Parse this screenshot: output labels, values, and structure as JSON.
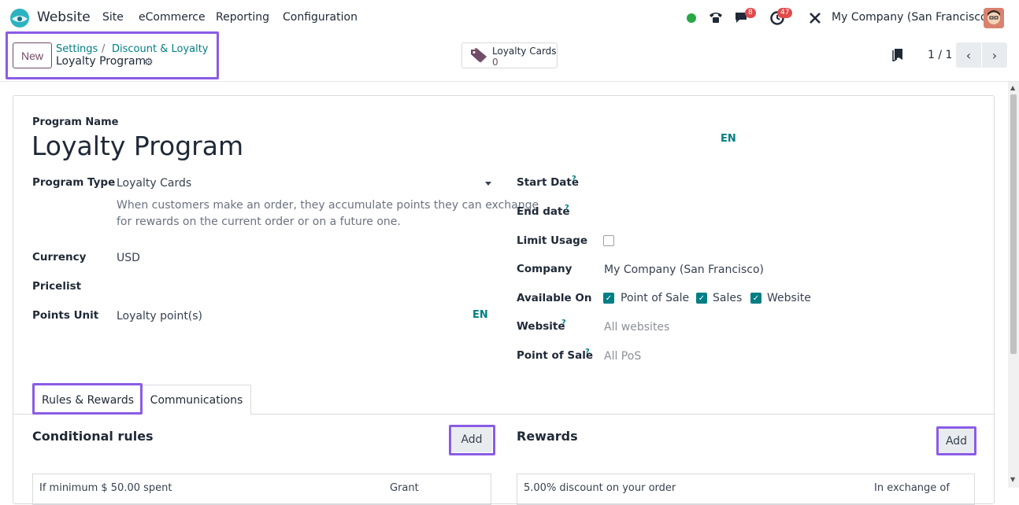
{
  "topbar": {
    "app_name": "Website",
    "menu": [
      "Site",
      "eCommerce",
      "Reporting",
      "Configuration"
    ],
    "messages_count": "8",
    "activities_count": "47",
    "company": "My Company (San Francisco)"
  },
  "control": {
    "new_label": "New",
    "breadcrumb": [
      "Settings",
      "Discount & Loyalty"
    ],
    "breadcrumb_sep": "/",
    "current": "Loyalty Program",
    "smart_label": "Loyalty Cards",
    "smart_value": "0",
    "pager": "1 / 1"
  },
  "form": {
    "program_name_label": "Program Name",
    "program_name": "Loyalty Program",
    "lang": "EN",
    "program_type_label": "Program Type",
    "program_type": "Loyalty Cards",
    "program_desc_1": "When customers make an order, they accumulate points they can exchange",
    "program_desc_2": "for rewards on the current order or on a future one.",
    "currency_label": "Currency",
    "currency": "USD",
    "pricelist_label": "Pricelist",
    "points_unit_label": "Points Unit",
    "points_unit": "Loyalty point(s)",
    "start_date_label": "Start Date",
    "end_date_label": "End date",
    "limit_usage_label": "Limit Usage",
    "company_label": "Company",
    "company": "My Company (San Francisco)",
    "available_on_label": "Available On",
    "available_on": [
      "Point of Sale",
      "Sales",
      "Website"
    ],
    "website_label": "Website",
    "website_placeholder": "All websites",
    "pos_label": "Point of Sale",
    "pos_placeholder": "All PoS",
    "help_mark": "?"
  },
  "tabs": [
    "Rules & Rewards",
    "Communications"
  ],
  "rules": {
    "title": "Conditional rules",
    "add_label": "Add",
    "row_text": "If minimum $ 50.00 spent",
    "row_right": "Grant"
  },
  "rewards": {
    "title": "Rewards",
    "add_label": "Add",
    "row_text": "5.00% discount on your order",
    "row_right": "In exchange of"
  }
}
